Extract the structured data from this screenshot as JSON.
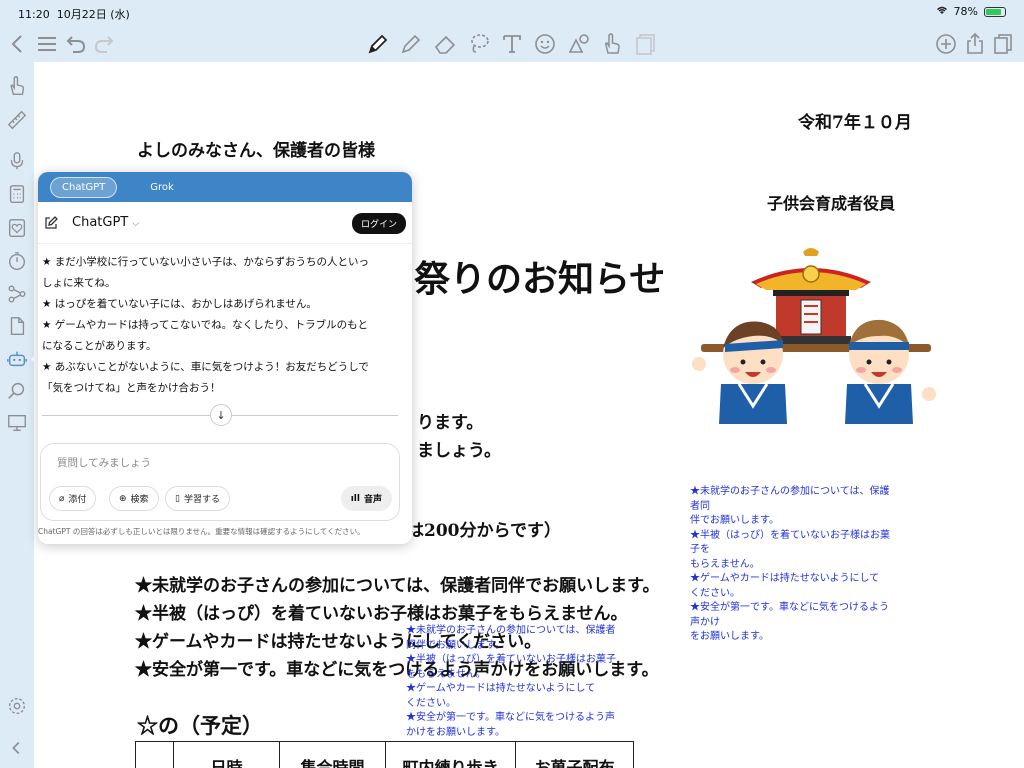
{
  "status": {
    "time": "11:20",
    "date": "10月22日 (水)",
    "battery": "78%"
  },
  "toolbar": {
    "left": [
      "back-icon",
      "menu-icon",
      "undo-icon",
      "redo-icon"
    ],
    "tools": [
      "pen-icon",
      "pencil-icon",
      "eraser-icon",
      "lasso-icon",
      "text-icon",
      "sticker-icon",
      "shapes-icon",
      "hand-icon",
      "image-icon"
    ],
    "right": [
      "add-page-icon",
      "share-icon",
      "pages-icon"
    ]
  },
  "document": {
    "date": "令和7年１０月",
    "recipient": "よしのみなさん、保護者の皆様",
    "sender": "子供会育成者役員",
    "title": "祭りのお知らせ",
    "line1": "ります。",
    "line2": "ましょう。",
    "line3": "は200分からです）",
    "rules": [
      "★未就学のお子さんの参加については、保護者同伴でお願いします。",
      "★半被（はっぴ）を着ていないお子様はお菓子をもらえません。",
      "★ゲームやカードは持たせないようにしてください。",
      "★安全が第一です。車などに気をつけるよう声かけをお願いします。"
    ],
    "schedule_heading": "☆の（予定）",
    "table_headers": [
      "",
      "日時",
      "集合時間",
      "町内練り歩き",
      "お菓子配布"
    ],
    "blue_notes_right": [
      "★未就学のお子さんの参加については、保護者同",
      "伴でお願いします。",
      "★半被（はっぴ）を着ていないお子様はお菓子を",
      "もらえません。",
      "★ゲームやカードは持たせないようにして",
      "ください。",
      "★安全が第一です。車などに気をつけるよう声かけ",
      "をお願いします。"
    ],
    "blue_notes_center": [
      "★未就学のお子さんの参加については、保護者",
      "同伴でお願いします。",
      "★半被（はっぴ）を着ていないお子様はお菓子",
      "をもらえません。",
      "★ゲームやカードは持たせないようにして",
      "ください。",
      "★安全が第一です。車などに気をつけるよう声",
      "かけをお願いします。"
    ]
  },
  "chat": {
    "tabs": [
      "ChatGPT",
      "Grok"
    ],
    "model": "ChatGPT",
    "login": "ログイン",
    "messages": [
      "★ まだ小学校に行っていない小さい子は、かならずおうちの人といっ",
      "しょに来てね。",
      "★ はっぴを着ていない子には、おかしはあげられません。",
      "★ ゲームやカードは持ってこないでね。なくしたり、トラブルのもと",
      "になることがあります。",
      "★ あぶないことがないように、車に気をつけよう！お友だちどうしで",
      "「気をつけてね」と声をかけ合おう！"
    ],
    "input_placeholder": "質問してみましょう",
    "chips": [
      "添付",
      "検索",
      "学習する"
    ],
    "voice": "音声",
    "disclaimer": "ChatGPT の回答は必ずしも正しいとは限りません。重要な情報は確認するようにしてください。"
  },
  "colors": {
    "chat_header": "#3d85c6",
    "blue_notes": "#2233dd",
    "app_chrome": "#ddebf6"
  }
}
